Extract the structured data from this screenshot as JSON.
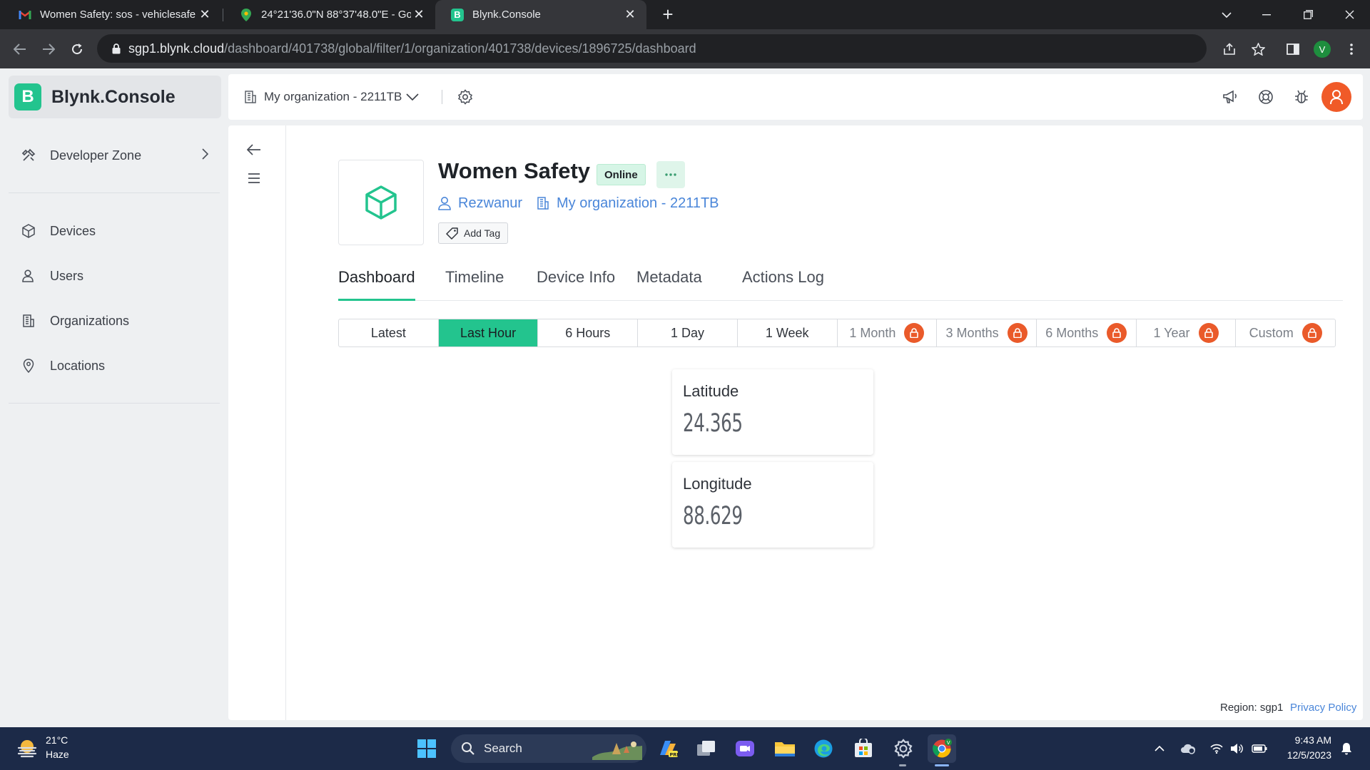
{
  "browser": {
    "tabs": [
      {
        "title": "Women Safety: sos - vehiclesafe",
        "icon": "gmail-icon"
      },
      {
        "title": "24°21'36.0\"N 88°37'48.0\"E - Goo",
        "icon": "maps-pin-icon"
      },
      {
        "title": "Blynk.Console",
        "icon": "blynk-icon",
        "active": true
      }
    ],
    "url_host": "sgp1.blynk.cloud",
    "url_path": "/dashboard/401738/global/filter/1/organization/401738/devices/1896725/dashboard",
    "profile_initial": "V"
  },
  "sidebar": {
    "brand_letter": "B",
    "brand_name": "Blynk.Console",
    "developer_zone": "Developer Zone",
    "items": [
      {
        "label": "Devices",
        "icon": "cube-icon"
      },
      {
        "label": "Users",
        "icon": "users-icon"
      },
      {
        "label": "Organizations",
        "icon": "building-icon"
      },
      {
        "label": "Locations",
        "icon": "location-pin-icon"
      }
    ]
  },
  "topbar": {
    "organization": "My organization - 2211TB"
  },
  "device": {
    "name": "Women Safety",
    "status": "Online",
    "owner": "Rezwanur",
    "organization": "My organization - 2211TB",
    "add_tag": "Add Tag"
  },
  "tabs": [
    "Dashboard",
    "Timeline",
    "Device Info",
    "Metadata",
    "Actions Log"
  ],
  "ranges": [
    {
      "label": "Latest",
      "locked": false
    },
    {
      "label": "Last Hour",
      "locked": false,
      "active": true
    },
    {
      "label": "6 Hours",
      "locked": false
    },
    {
      "label": "1 Day",
      "locked": false
    },
    {
      "label": "1 Week",
      "locked": false
    },
    {
      "label": "1 Month",
      "locked": true
    },
    {
      "label": "3 Months",
      "locked": true
    },
    {
      "label": "6 Months",
      "locked": true
    },
    {
      "label": "1 Year",
      "locked": true
    },
    {
      "label": "Custom",
      "locked": true
    }
  ],
  "widgets": [
    {
      "label": "Latitude",
      "value": "24.365"
    },
    {
      "label": "Longitude",
      "value": "88.629"
    }
  ],
  "footer": {
    "region": "Region: sgp1",
    "privacy": "Privacy Policy"
  },
  "taskbar": {
    "temperature": "21°C",
    "condition": "Haze",
    "search": "Search",
    "time": "9:43 AM",
    "date": "12/5/2023"
  },
  "colors": {
    "accent": "#23c48e",
    "link": "#4a86d9",
    "lock": "#ea5a2a",
    "avatar": "#f05a28"
  }
}
